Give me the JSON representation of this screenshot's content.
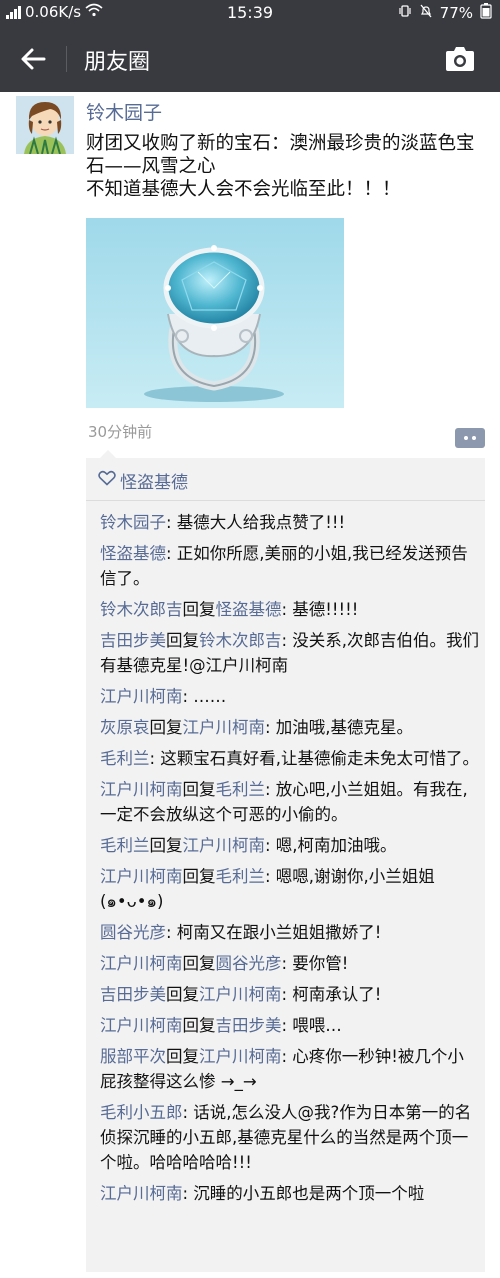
{
  "status_bar": {
    "network": "0.06K/s",
    "time": "15:39",
    "battery": "77%",
    "icons": [
      "signal-icon",
      "wifi-icon",
      "vibrate-icon",
      "mute-icon",
      "battery-icon"
    ]
  },
  "nav": {
    "title": "朋友圈",
    "back_icon": "back-arrow-icon",
    "camera_icon": "camera-icon"
  },
  "post": {
    "author": "铃木园子",
    "text_line1": "财团又收购了新的宝石：澳洲最珍贵的淡蓝色宝石——风雪之心",
    "text_line2": "不知道基德大人会不会光临至此！！！",
    "time_ago": "30分钟前"
  },
  "likes": {
    "names": "怪盗基德"
  },
  "comments": [
    {
      "name": "铃木园子",
      "reply_word": "",
      "to": "",
      "text": ": 基德大人给我点赞了!!!"
    },
    {
      "name": "怪盗基德",
      "reply_word": "",
      "to": "",
      "text": ": 正如你所愿,美丽的小姐,我已经发送预告信了。"
    },
    {
      "name": "铃木次郎吉",
      "reply_word": "回复",
      "to": "怪盗基德",
      "text": ": 基德!!!!!"
    },
    {
      "name": "吉田步美",
      "reply_word": "回复",
      "to": "铃木次郎吉",
      "text": ": 没关系,次郎吉伯伯。我们有基德克星!@江户川柯南"
    },
    {
      "name": "江户川柯南",
      "reply_word": "",
      "to": "",
      "text": ": ……"
    },
    {
      "name": "灰原哀",
      "reply_word": "回复",
      "to": "江户川柯南",
      "text": ": 加油哦,基德克星。"
    },
    {
      "name": "毛利兰",
      "reply_word": "",
      "to": "",
      "text": ": 这颗宝石真好看,让基德偷走未免太可惜了。"
    },
    {
      "name": "江户川柯南",
      "reply_word": "回复",
      "to": "毛利兰",
      "text": ": 放心吧,小兰姐姐。有我在,一定不会放纵这个可恶的小偷的。"
    },
    {
      "name": "毛利兰",
      "reply_word": "回复",
      "to": "江户川柯南",
      "text": ": 嗯,柯南加油哦。"
    },
    {
      "name": "江户川柯南",
      "reply_word": "回复",
      "to": "毛利兰",
      "text": ": 嗯嗯,谢谢你,小兰姐姐(๑•ᴗ•๑)"
    },
    {
      "name": "圆谷光彦",
      "reply_word": "",
      "to": "",
      "text": ": 柯南又在跟小兰姐姐撒娇了!"
    },
    {
      "name": "江户川柯南",
      "reply_word": "回复",
      "to": "圆谷光彦",
      "text": ": 要你管!"
    },
    {
      "name": "吉田步美",
      "reply_word": "回复",
      "to": "江户川柯南",
      "text": ": 柯南承认了!"
    },
    {
      "name": "江户川柯南",
      "reply_word": "回复",
      "to": "吉田步美",
      "text": ": 喂喂…"
    },
    {
      "name": "服部平次",
      "reply_word": "回复",
      "to": "江户川柯南",
      "text": ": 心疼你一秒钟!被几个小屁孩整得这么惨 →_→"
    },
    {
      "name": "毛利小五郎",
      "reply_word": "",
      "to": "",
      "text": ": 话说,怎么没人@我?作为日本第一的名侦探沉睡的小五郎,基德克星什么的当然是两个顶一个啦。哈哈哈哈哈!!!"
    },
    {
      "name": "江户川柯南",
      "reply_word": "",
      "to": "",
      "text": ": 沉睡的小五郎也是两个顶一个啦"
    }
  ],
  "colors": {
    "bar": "#393a3f",
    "link": "#576b95",
    "comment_bg": "#f2f2f2",
    "gem": "#4fb6d0"
  }
}
